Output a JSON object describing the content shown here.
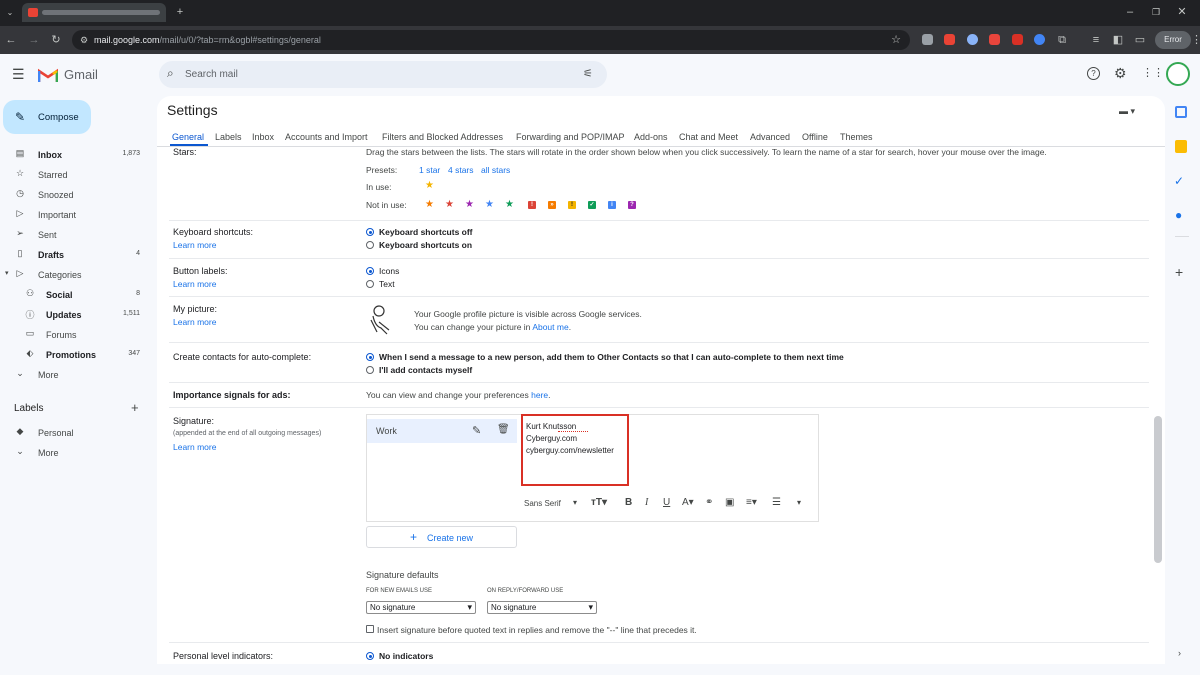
{
  "browser": {
    "url_host": "mail.google.com",
    "url_path": "/mail/u/0/?tab=rm&ogbl#settings/general",
    "profile_button": "Error"
  },
  "gmail": {
    "logo_text": "Gmail",
    "search_placeholder": "Search mail",
    "compose_label": "Compose"
  },
  "sidebar": {
    "items": [
      {
        "label": "Inbox",
        "count": "1,873",
        "icon": "inbox-icon",
        "bold": true
      },
      {
        "label": "Starred",
        "count": "",
        "icon": "star-icon"
      },
      {
        "label": "Snoozed",
        "count": "",
        "icon": "clock-icon"
      },
      {
        "label": "Important",
        "count": "",
        "icon": "important-icon"
      },
      {
        "label": "Sent",
        "count": "",
        "icon": "send-icon"
      },
      {
        "label": "Drafts",
        "count": "4",
        "icon": "draft-icon",
        "bold": true
      },
      {
        "label": "Categories",
        "count": "",
        "icon": "label-icon"
      },
      {
        "label": "Social",
        "count": "8",
        "icon": "people-icon",
        "bold": true
      },
      {
        "label": "Updates",
        "count": "1,511",
        "icon": "info-icon",
        "bold": true
      },
      {
        "label": "Forums",
        "count": "",
        "icon": "forum-icon"
      },
      {
        "label": "Promotions",
        "count": "347",
        "icon": "tag-icon",
        "bold": true
      },
      {
        "label": "More",
        "count": "",
        "icon": "chevron-down-icon"
      }
    ],
    "labels_heading": "Labels",
    "labels": [
      {
        "label": "Personal",
        "icon": "label-icon"
      },
      {
        "label": "More",
        "icon": "chevron-down-icon"
      }
    ]
  },
  "settings": {
    "title": "Settings",
    "tabs": [
      "General",
      "Labels",
      "Inbox",
      "Accounts and Import",
      "Filters and Blocked Addresses",
      "Forwarding and POP/IMAP",
      "Add-ons",
      "Chat and Meet",
      "Advanced",
      "Offline",
      "Themes"
    ],
    "active_tab": "General",
    "stars": {
      "label": "Stars:",
      "instructions": "Drag the stars between the lists.  The stars will rotate in the order shown below when you click successively. To learn the name of a star for search, hover your mouse over the image.",
      "presets_label": "Presets:",
      "presets": [
        "1 star",
        "4 stars",
        "all stars"
      ],
      "in_use_label": "In use:",
      "not_in_use_label": "Not in use:"
    },
    "keyboard": {
      "label": "Keyboard shortcuts:",
      "learn_more": "Learn more",
      "options": [
        "Keyboard shortcuts off",
        "Keyboard shortcuts on"
      ],
      "selected": 0
    },
    "button_labels": {
      "label": "Button labels:",
      "learn_more": "Learn more",
      "options": [
        "Icons",
        "Text"
      ],
      "selected": 0
    },
    "my_picture": {
      "label": "My picture:",
      "learn_more": "Learn more",
      "line1": "Your Google profile picture is visible across Google services.",
      "line2_prefix": "You can change your picture in",
      "line2_link": "About me",
      "line2_suffix": "."
    },
    "auto_complete": {
      "label": "Create contacts for auto-complete:",
      "options": [
        "When I send a message to a new person, add them to Other Contacts so that I can auto-complete to them next time",
        "I'll add contacts myself"
      ],
      "selected": 0
    },
    "importance": {
      "label": "Importance signals for ads:",
      "text": "You can view and change your preferences",
      "link": "here",
      "suffix": "."
    },
    "signature": {
      "label": "Signature:",
      "sublabel": "(appended at the end of all outgoing messages)",
      "learn_more": "Learn more",
      "item_name": "Work",
      "lines": [
        "Kurt Knutsson",
        "Cyberguy.com",
        "cyberguy.com/newsletter"
      ],
      "font": "Sans Serif",
      "create_new": "Create new",
      "defaults_heading": "Signature defaults",
      "new_emails_label": "FOR NEW EMAILS USE",
      "new_emails_value": "No signature",
      "reply_label": "ON REPLY/FORWARD USE",
      "reply_value": "No signature",
      "insert_checkbox": "Insert signature before quoted text in replies and remove the \"--\" line that precedes it."
    },
    "personal_level": {
      "label": "Personal level indicators:",
      "option": "No indicators"
    }
  },
  "colors": {
    "accent": "#0b57d0",
    "highlight_box": "#d93025",
    "compose_bg": "#c2e7ff"
  }
}
